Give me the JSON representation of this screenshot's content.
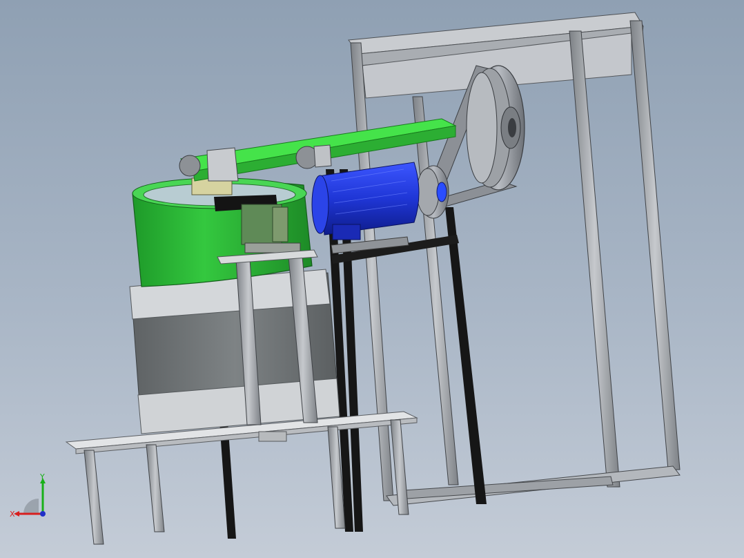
{
  "app": {
    "view": "cad-3d-viewport"
  },
  "triad": {
    "x_label": "X",
    "y_label": "Y",
    "colors": {
      "x": "#d81e1e",
      "y": "#18b018",
      "z": "#2030c8"
    }
  },
  "model": {
    "parts": [
      "aluminum-profile-frame",
      "vibratory-bowl-feeder",
      "green-conveyor-belt",
      "blue-servo-motor",
      "belt-pulley-drive",
      "base-plate",
      "support-legs"
    ],
    "colors": {
      "bowl_green": "#2fbf3a",
      "belt_green": "#45e34a",
      "motor_blue": "#1f36d6",
      "frame_gray": "#9ea2a8",
      "base_gray": "#6f7476",
      "plate": "#e2e4e6",
      "post_black": "#141414"
    }
  }
}
